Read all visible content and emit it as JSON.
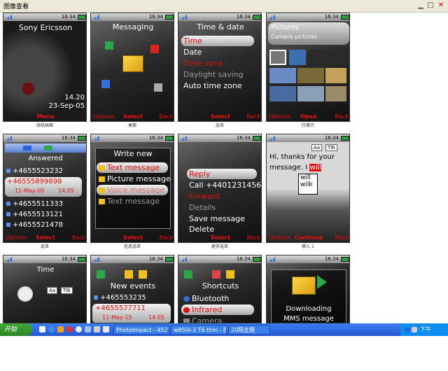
{
  "window": {
    "title": "图像查看",
    "min_glyph": "▁",
    "max_glyph": "□",
    "close_glyph": "✕"
  },
  "status_time": "16:34",
  "cells": {
    "c1": {
      "brand": "Sony Ericsson",
      "time": "14.20",
      "date": "23-Sep-05",
      "sk_center": "Menu",
      "caption": "待机画面"
    },
    "c2": {
      "header": "Messaging",
      "sk_left": "Options",
      "sk_center": "Select",
      "sk_right": "Back",
      "caption": "桌面"
    },
    "c3": {
      "header": "Time & date",
      "items": [
        "Time",
        "Date",
        "Time zone",
        "Daylight saving",
        "Auto time zone"
      ],
      "sk_center": "Select",
      "sk_right": "Back",
      "caption": "选单"
    },
    "c4": {
      "header": "Pictures",
      "subheader": "Camera pictures",
      "sk_left": "Options",
      "sk_center": "Open",
      "sk_right": "Back",
      "caption": "行事历"
    },
    "c5": {
      "header": "Answered",
      "items": [
        "+4655523232",
        "+46555899898",
        "+4655511333",
        "+4655513121",
        "+4655521478"
      ],
      "sel_date": "11-May-05",
      "sel_time": "14.05",
      "sk_left": "Options",
      "sk_center": "Select",
      "sk_right": "Back",
      "caption": "选单"
    },
    "c6": {
      "header": "Write new",
      "items": [
        "Text message",
        "Picture message",
        "Voice message",
        "Text message"
      ],
      "sk_center": "Select",
      "sk_right": "Back",
      "caption": "信息选单"
    },
    "c7": {
      "items": [
        "Reply",
        "Call +4401231456",
        "Forward",
        "Details",
        "Save message",
        "Delete"
      ],
      "sk_center": "Select",
      "sk_right": "Back",
      "caption": "更多选单"
    },
    "c8": {
      "tag_aa": "Aa",
      "tag_t9": "T9i",
      "text_a": "Hi, thanks for your",
      "text_b": "message. I",
      "text_hl": "will",
      "sugg": [
        "will",
        "wilk"
      ],
      "sk_left": "Options",
      "sk_center": "Continue",
      "sk_right": "Back",
      "caption": "输入 1"
    },
    "c9": {
      "header": "Time",
      "tag_aa": "Aa",
      "tag_t9": "T9i"
    },
    "c10": {
      "header": "New events",
      "items": [
        "+465553235",
        "+4655577711"
      ],
      "sel_date": "11-May-15",
      "sel_time": "14.05"
    },
    "c11": {
      "header": "Shortcuts",
      "items": [
        "Bluetooth",
        "Infrared",
        "Camera"
      ]
    },
    "c12": {
      "line1": "Downloading",
      "line2": "MMS message"
    }
  },
  "taskbar": {
    "start": "开始",
    "items": [
      "PhotoImpact - 452752E",
      "w850i-3 T6.thm - 图片",
      "20阳主题"
    ],
    "clock": "下午 01:38"
  },
  "colors": {
    "accent_red": "#e01010",
    "xp_blue": "#2458d1",
    "start_green": "#2c8424"
  }
}
